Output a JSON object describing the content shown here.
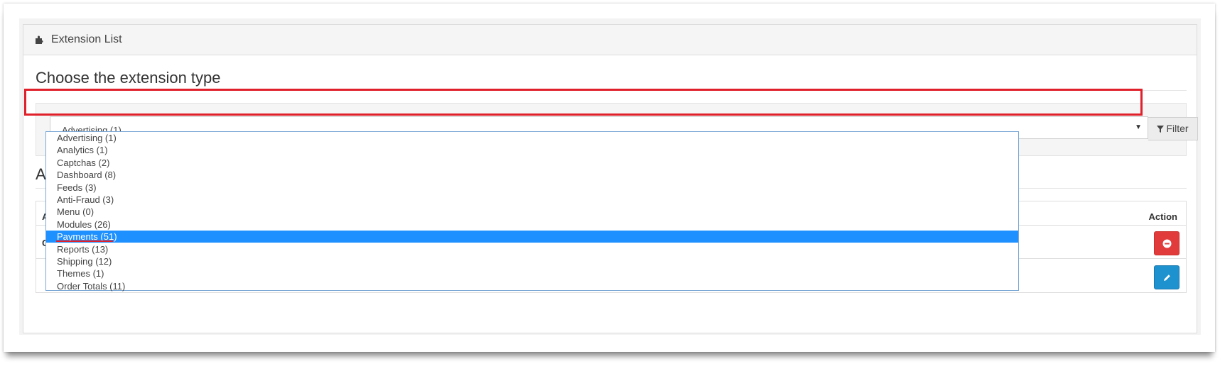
{
  "panel": {
    "title": "Extension List",
    "icon": "puzzle-icon"
  },
  "choose": {
    "title": "Choose the extension type"
  },
  "type_select": {
    "value": "Advertising (1)",
    "filter_label": "Filter",
    "options": [
      "Advertising (1)",
      "Analytics (1)",
      "Captchas (2)",
      "Dashboard (8)",
      "Feeds (3)",
      "Anti-Fraud (3)",
      "Menu (0)",
      "Modules (26)",
      "Payments (51)",
      "Reports (13)",
      "Shipping (12)",
      "Themes (1)",
      "Order Totals (11)"
    ],
    "highlighted_index": 8
  },
  "available": {
    "title_visible": "Ac"
  },
  "table": {
    "header_name_visible": "Ac",
    "header_action": "Action",
    "row1_name_visible": "G"
  },
  "colors": {
    "annotation_red": "#e0202a",
    "selected_option": "#1e90ff",
    "uninstall_button": "#e23b3b",
    "edit_button": "#1e91cf"
  }
}
